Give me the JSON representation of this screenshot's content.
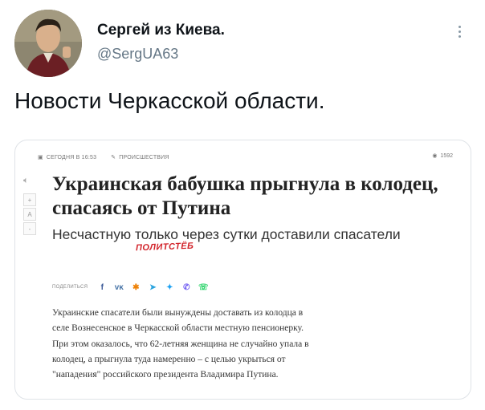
{
  "author": {
    "name": "Сергей из Киева.",
    "handle": "@SergUA63"
  },
  "tweet": {
    "text": "Новости Черкасской области."
  },
  "article": {
    "meta_date": "СЕГОДНЯ В 16:53",
    "meta_tag": "ПРОИСШЕСТВИЯ",
    "views": "1592",
    "headline": "Украинская бабушка прыгнула в колодец, спасаясь от Путина",
    "subtitle": "Несчастную только через сутки доставили спасатели",
    "stamp": "ПОЛИТСТЁБ",
    "share_label": "ПОДЕЛИТЬСЯ",
    "share_icons": [
      {
        "name": "facebook-icon",
        "glyph": "f",
        "color": "#3b5998"
      },
      {
        "name": "vk-icon",
        "glyph": "vk",
        "color": "#4a76a8"
      },
      {
        "name": "ok-icon",
        "glyph": "ok",
        "color": "#ee8208"
      },
      {
        "name": "telegram-icon",
        "glyph": "tg",
        "color": "#2aa3de"
      },
      {
        "name": "twitter-icon",
        "glyph": "tw",
        "color": "#1da1f2"
      },
      {
        "name": "viber-icon",
        "glyph": "vb",
        "color": "#7360f2"
      },
      {
        "name": "whatsapp-icon",
        "glyph": "wa",
        "color": "#25d366"
      }
    ],
    "left_tools": [
      "+",
      "A",
      "-"
    ],
    "body_lines": [
      "Украинские спасатели были вынуждены доставать из колодца в",
      "селе Вознесенское в Черкасской области местную пенсионерку.",
      "При этом оказалось, что 62-летняя женщина не случайно упала в",
      "колодец, а прыгнула туда намеренно – с целью укрыться от",
      "\"нападения\" российского президента Владимира Путина."
    ]
  }
}
